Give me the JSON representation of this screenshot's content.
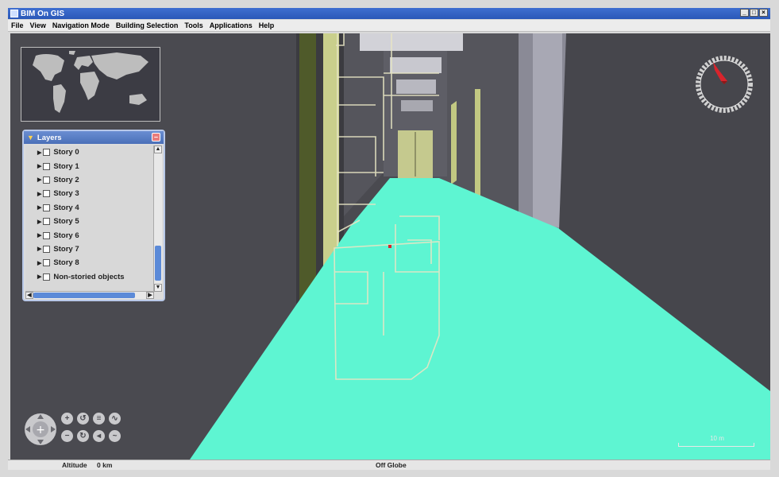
{
  "window": {
    "title": "BIM On GIS",
    "controls": {
      "minimize": "_",
      "maximize": "□",
      "close": "×"
    }
  },
  "menu": [
    "File",
    "View",
    "Navigation Mode",
    "Building Selection",
    "Tools",
    "Applications",
    "Help"
  ],
  "layers": {
    "title": "Layers",
    "items": [
      "Story 0",
      "Story 1",
      "Story 2",
      "Story 3",
      "Story 4",
      "Story 5",
      "Story 6",
      "Story 7",
      "Story 8",
      "Non-storied objects"
    ]
  },
  "scale": {
    "label": "10 m"
  },
  "status": {
    "altitude_label": "Altitude",
    "altitude_value": "0 km",
    "globe_status": "Off Globe"
  },
  "colors": {
    "floor": "#5ef5d2",
    "wall": "#4a4a50",
    "accent_compass": "#d8242c",
    "pillar": "#bcc57a"
  },
  "icons": [
    "compass-icon",
    "pan-icon",
    "zoom-in-icon",
    "zoom-out-icon",
    "rotate-left-icon",
    "rotate-right-icon",
    "tilt-up-icon",
    "tilt-down-icon",
    "layers-icon"
  ]
}
